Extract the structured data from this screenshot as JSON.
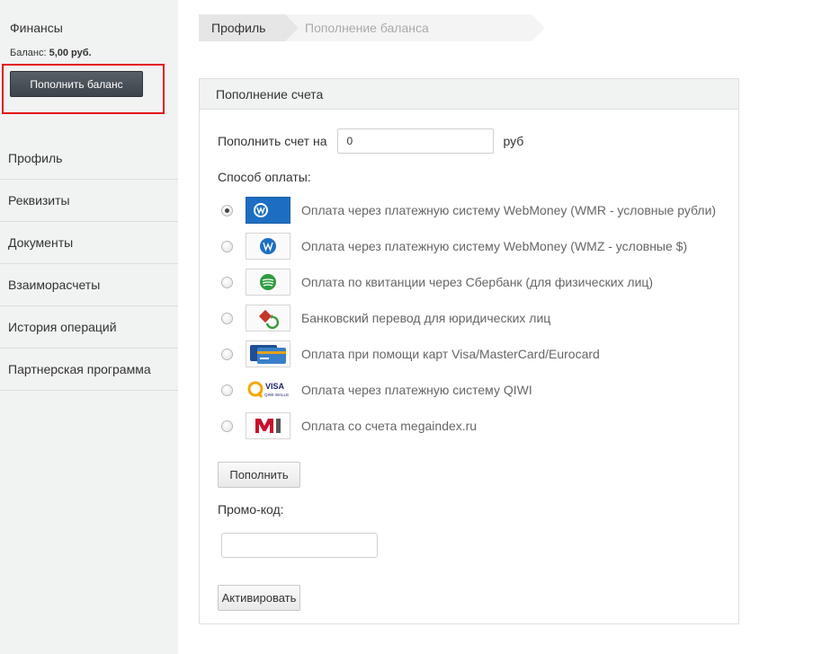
{
  "sidebar": {
    "finance_title": "Финансы",
    "balance_label": "Баланс:",
    "balance_value": "5,00 руб.",
    "topup_button": "Пополнить баланс",
    "menu": [
      {
        "label": "Профиль"
      },
      {
        "label": "Реквизиты"
      },
      {
        "label": "Документы"
      },
      {
        "label": "Взаиморасчеты"
      },
      {
        "label": "История операций"
      },
      {
        "label": "Партнерская программа"
      }
    ]
  },
  "breadcrumb": {
    "items": [
      {
        "label": "Профиль"
      },
      {
        "label": "Пополнение баланса"
      }
    ]
  },
  "panel": {
    "title": "Пополнение счета",
    "amount_label": "Пополнить счет на",
    "amount_value": "0",
    "currency": "руб",
    "method_title": "Способ оплаты:",
    "methods": [
      {
        "label": "Оплата через платежную систему WebMoney (WMR - условные рубли)",
        "icon": "webmoney-icon",
        "checked": true
      },
      {
        "label": "Оплата через платежную систему WebMoney (WMZ - условные $)",
        "icon": "webmoney-icon",
        "checked": false
      },
      {
        "label": "Оплата по квитанции через Сбербанк (для физических лиц)",
        "icon": "sberbank-icon",
        "checked": false
      },
      {
        "label": "Банковский перевод для юридических лиц",
        "icon": "bank-transfer-icon",
        "checked": false
      },
      {
        "label": "Оплата при помощи карт Visa/MasterCard/Eurocard",
        "icon": "credit-card-icon",
        "checked": false
      },
      {
        "label": "Оплата через платежную систему QIWI",
        "icon": "qiwi-icon",
        "checked": false
      },
      {
        "label": "Оплата со счета megaindex.ru",
        "icon": "megaindex-icon",
        "checked": false
      }
    ],
    "pay_button": "Пополнить",
    "promo_label": "Промо-код:",
    "promo_value": "",
    "activate_button": "Активировать"
  },
  "colors": {
    "sidebar_bg": "#f1f2f2",
    "highlight_border": "#e3141b",
    "dark_button": "#464d54",
    "webmoney_blue": "#1d6ec2",
    "sber_green": "#2e9c3f",
    "megaindex_red": "#c8102e"
  }
}
